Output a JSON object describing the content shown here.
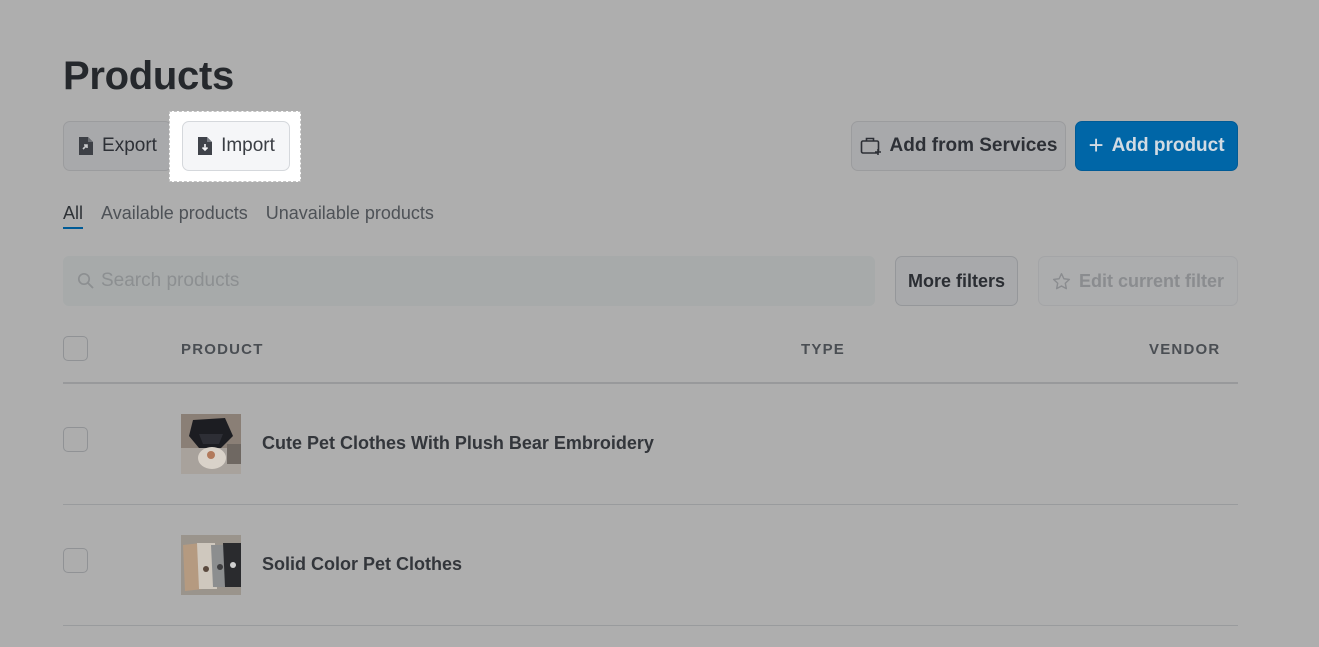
{
  "page": {
    "title": "Products"
  },
  "toolbar": {
    "export_label": "Export",
    "import_label": "Import",
    "services_label": "Add from Services",
    "add_label": "Add product",
    "add_plus": "+"
  },
  "tabs": [
    {
      "label": "All",
      "active": true
    },
    {
      "label": "Available products",
      "active": false
    },
    {
      "label": "Unavailable products",
      "active": false
    }
  ],
  "search": {
    "placeholder": "Search products"
  },
  "filters": {
    "more_label": "More filters",
    "edit_label": "Edit current filter"
  },
  "table": {
    "columns": [
      "PRODUCT",
      "TYPE",
      "VENDOR"
    ],
    "rows": [
      {
        "name": "Cute Pet Clothes With Plush Bear Embroidery",
        "type": "",
        "vendor": ""
      },
      {
        "name": "Solid Color Pet Clothes",
        "type": "",
        "vendor": ""
      }
    ]
  },
  "colors": {
    "overlay": "#aeaeae",
    "accent": "#0066a7",
    "focus_bg": "#ffffff"
  },
  "icons": {
    "export": "file-export-icon",
    "import": "file-import-icon",
    "services": "services-box-icon",
    "search": "search-icon",
    "star": "star-icon"
  }
}
